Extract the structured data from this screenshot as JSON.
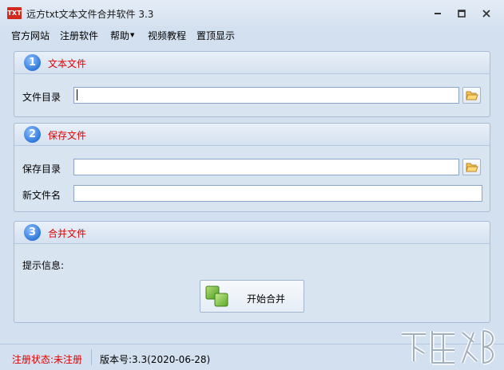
{
  "window": {
    "title": "远方txt文本文件合并软件 3.3",
    "app_icon_text": "TXT"
  },
  "menu": {
    "items": [
      {
        "label": "官方网站"
      },
      {
        "label": "注册软件"
      },
      {
        "label": "帮助",
        "has_dropdown": true
      },
      {
        "label": "视频教程"
      },
      {
        "label": "置顶显示"
      }
    ]
  },
  "panels": {
    "text_files": {
      "step": "1",
      "title": "文本文件",
      "dir_label": "文件目录",
      "dir_value": ""
    },
    "save_files": {
      "step": "2",
      "title": "保存文件",
      "dir_label": "保存目录",
      "dir_value": "",
      "name_label": "新文件名",
      "name_value": ""
    },
    "merge": {
      "step": "3",
      "title": "合并文件",
      "info_label": "提示信息:",
      "button_label": "开始合并"
    }
  },
  "status": {
    "registration": "注册状态:未注册",
    "version": "版本号:3.3(2020-06-28)"
  },
  "colors": {
    "accent_red": "#e00000",
    "step_blue": "#2f78d8",
    "background": "#d3e0ef"
  },
  "icons": [
    "app-icon",
    "minimize-icon",
    "maximize-icon",
    "close-icon",
    "folder-open-icon",
    "merge-icon"
  ]
}
